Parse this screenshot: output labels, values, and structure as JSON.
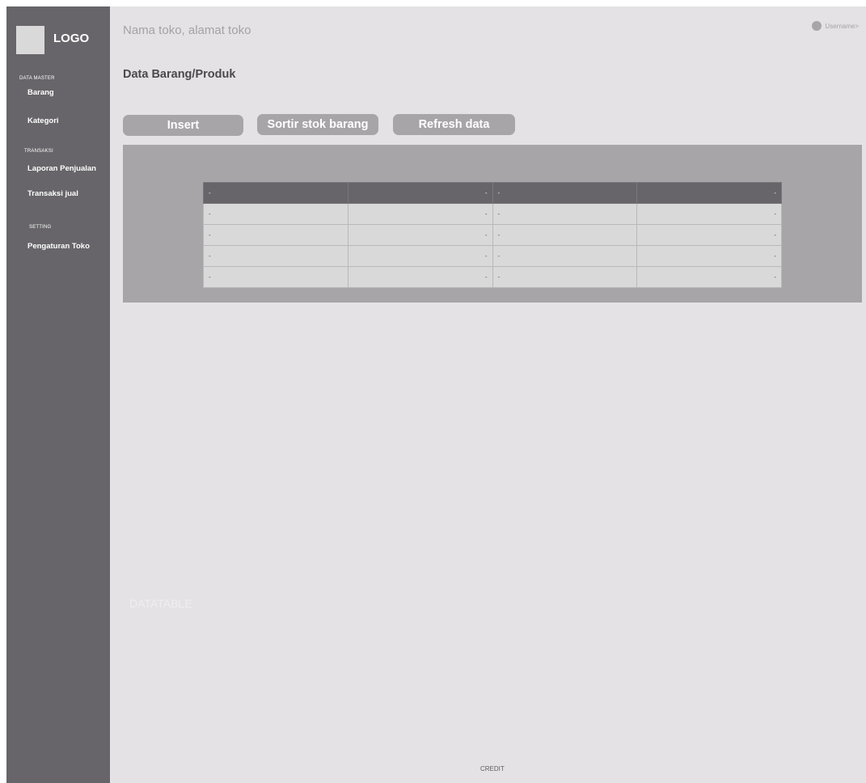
{
  "app": {
    "logo_text": "LOGO",
    "store_title": "Nama toko, alamat toko",
    "username": "Username>"
  },
  "sidebar": {
    "sections": [
      {
        "label": "DATA MASTER",
        "items": [
          "Barang",
          "Kategori"
        ]
      },
      {
        "label": "TRANSAKSI",
        "items": [
          "Laporan Penjualan",
          "Transaksi jual"
        ]
      },
      {
        "label": "SETTING",
        "items": [
          "Pengaturan Toko"
        ]
      }
    ]
  },
  "main": {
    "page_title": "Data Barang/Produk",
    "buttons": {
      "insert": "Insert",
      "sort": "Sortir stok barang",
      "refresh": "Refresh data"
    },
    "table": {
      "header": [
        "-",
        "-",
        "-",
        "-"
      ],
      "rows": [
        [
          "-",
          "-",
          "-",
          "-"
        ],
        [
          "-",
          "-",
          "-",
          "-"
        ],
        [
          "-",
          "-",
          "-",
          "-"
        ],
        [
          "-",
          "-",
          "-",
          "-"
        ]
      ]
    },
    "datatable_label": "DATATABLE"
  },
  "footer": {
    "credit": "CREDIT"
  },
  "colors": {
    "sidebar": "#676569",
    "background": "#e4e2e4",
    "button": "#a7a5a8",
    "table_header": "#676569",
    "table_cell": "#d9d9d9"
  },
  "icons": {
    "user_avatar": "user-avatar-icon"
  }
}
